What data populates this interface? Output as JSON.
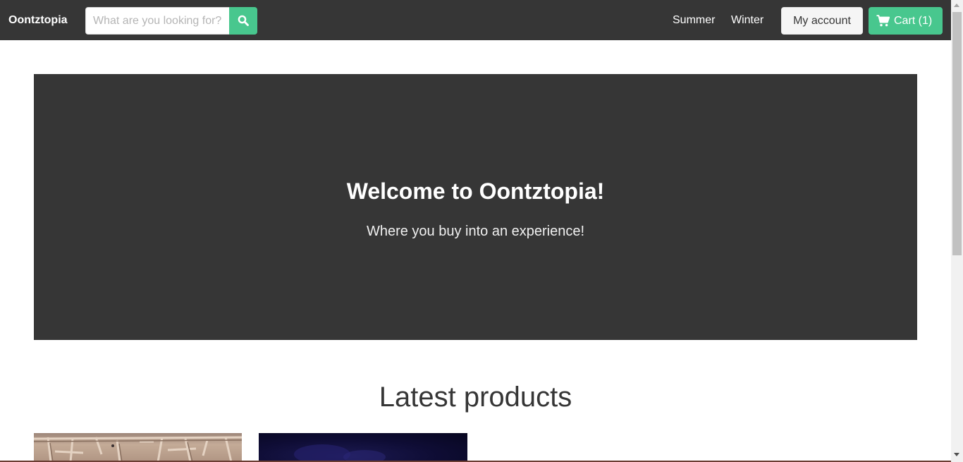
{
  "navbar": {
    "brand": "Oontztopia",
    "search": {
      "placeholder": "What are you looking for?",
      "value": "",
      "button_icon": "search-icon"
    },
    "links": [
      {
        "label": "Summer"
      },
      {
        "label": "Winter"
      }
    ],
    "account_label": "My account",
    "cart": {
      "label": "Cart (1)",
      "icon": "cart-icon"
    }
  },
  "hero": {
    "title": "Welcome to Oontztopia!",
    "subtitle": "Where you buy into an experience!"
  },
  "latest_products": {
    "title": "Latest products"
  },
  "colors": {
    "navbar_bg": "#363636",
    "hero_bg": "#363636",
    "accent": "#48c78e",
    "account_button_bg": "#f5f5f5"
  }
}
